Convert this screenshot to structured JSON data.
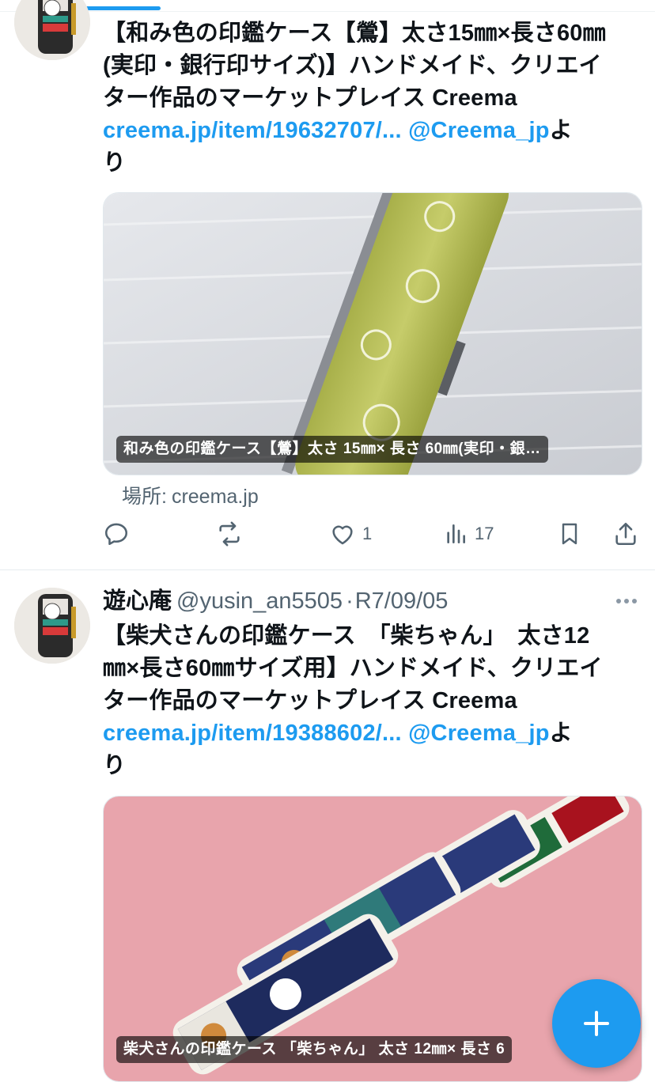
{
  "tweets": [
    {
      "text_lines": [
        "【和み色の印鑑ケース【鶯】太さ15㎜×長さ60㎜",
        "(実印・銀行印サイズ)】ハンドメイド、クリエイ",
        "ター作品のマーケットプレイス Creema"
      ],
      "link_text": "creema.jp/item/19632707/...",
      "mention": "@Creema_jp",
      "suffix_1": "よ",
      "suffix_2": "り",
      "media_caption": "和み色の印鑑ケース【鶯】太さ 15㎜× 長さ 60㎜(実印・銀…",
      "source_label": "場所:",
      "source_domain": "creema.jp",
      "like_count": "1",
      "view_count": "17"
    },
    {
      "author_name": "遊心庵",
      "author_handle": "@yusin_an5505",
      "separator": "·",
      "date": "R7/09/05",
      "text_lines": [
        "【柴犬さんの印鑑ケース　「柴ちゃん」　太さ12",
        "㎜×長さ60㎜サイズ用】ハンドメイド、クリエイ",
        "ター作品のマーケットプレイス Creema"
      ],
      "link_text": "creema.jp/item/19388602/...",
      "mention": "@Creema_jp",
      "suffix_1": "よ",
      "suffix_2": "り",
      "media_caption": "柴犬さんの印鑑ケース 「柴ちゃん」 太さ 12㎜× 長さ 6"
    }
  ],
  "fab_icon": "plus-icon",
  "colors": {
    "accent": "#1d9bf0",
    "secondary_text": "#536471",
    "primary_text": "#0f1419"
  }
}
